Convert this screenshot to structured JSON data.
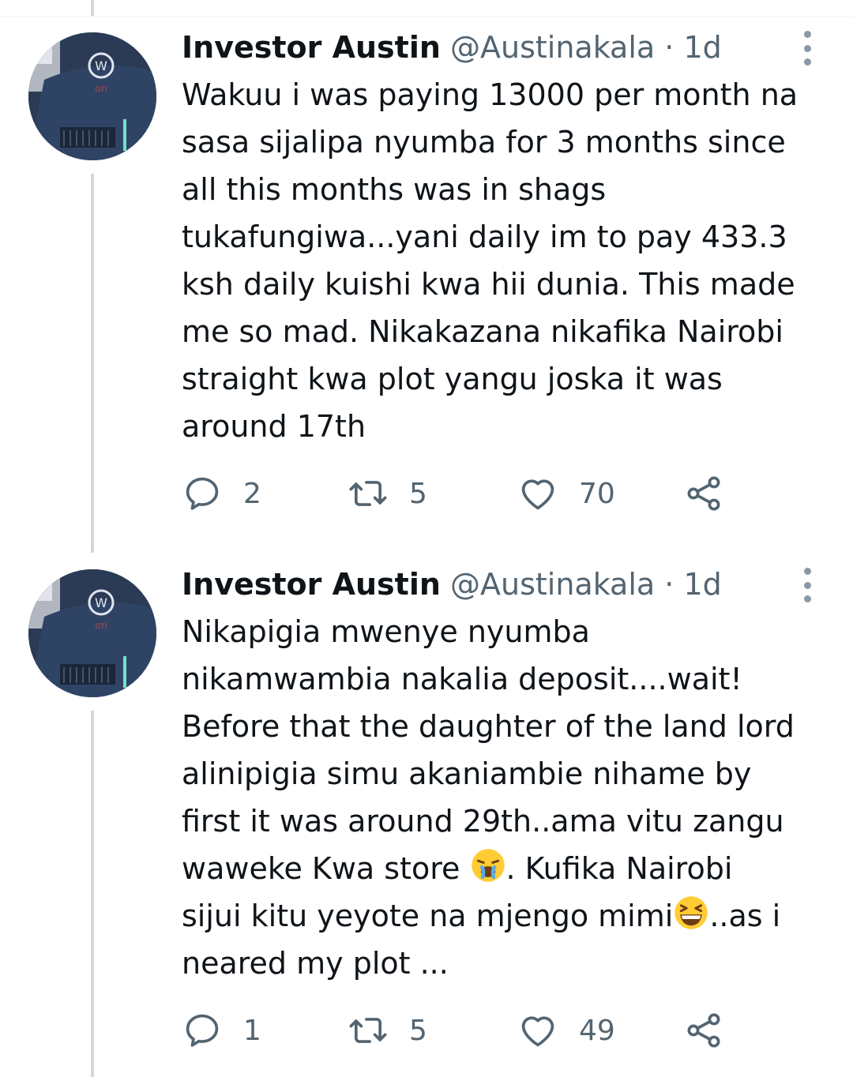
{
  "tweets": [
    {
      "author_name": "Investor Austin",
      "handle": "@Austinakala",
      "separator": "·",
      "time": "1d",
      "text": "Wakuu i was paying 13000 per month na\nsasa sijalipa nyumba for 3 months since\nall this months was in shags\ntukafungiwa...yani daily im to pay 433.3\nksh daily kuishi kwa hii dunia. This made\nme so mad. Nikakazana nikafika Nairobi\nstraight kwa plot yangu joska it was\naround 17th",
      "replies": "2",
      "retweets": "5",
      "likes": "70"
    },
    {
      "author_name": "Investor Austin",
      "handle": "@Austinakala",
      "separator": "·",
      "time": "1d",
      "text_a": "Nikapigia mwenye nyumba\nnikamwambia nakalia deposit....wait!\nBefore that the daughter of the land lord\nalinipigia simu akaniambie nihame by\nfirst it was around 29th..ama vitu zangu\nwaweke Kwa store ",
      "text_b": ". Kufika Nairobi\nsijui kitu yeyote na mjengo mimi",
      "text_c": "..as i\nneared my plot ...",
      "emoji_1": "crying-face-emoji",
      "emoji_2": "grinning-squinting-face-emoji",
      "replies": "1",
      "retweets": "5",
      "likes": "49"
    }
  ],
  "colors": {
    "text": "#0f1419",
    "muted": "#536471",
    "thread_line": "#cfd9de"
  }
}
